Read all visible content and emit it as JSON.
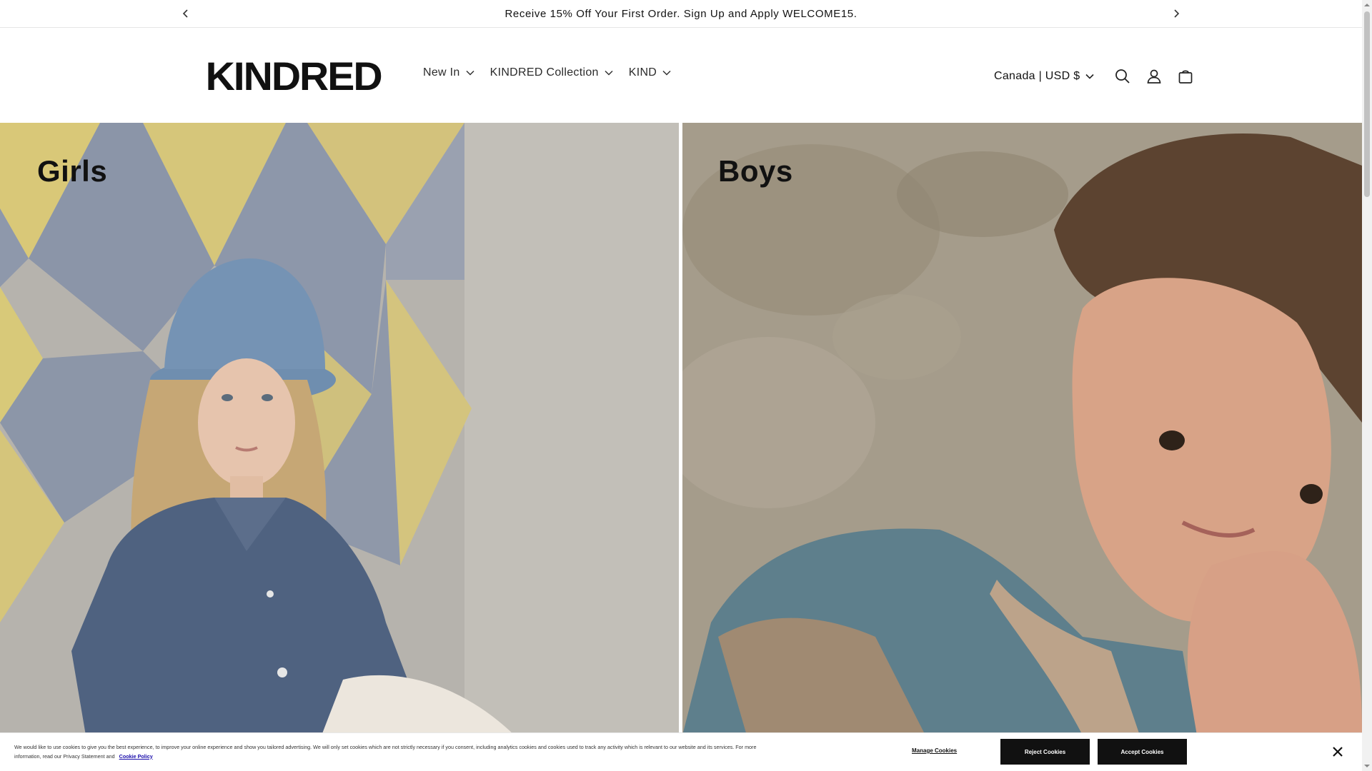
{
  "announcement": {
    "text": "Receive 15% Off Your First Order. Sign Up and Apply WELCOME15.",
    "prev_icon": "chevron-left-icon",
    "next_icon": "chevron-right-icon"
  },
  "header": {
    "logo": "KINDRED",
    "nav": [
      {
        "label": "New In"
      },
      {
        "label": "KINDRED Collection"
      },
      {
        "label": "KIND"
      }
    ],
    "currency": "Canada | USD $",
    "icons": [
      "search-icon",
      "account-icon",
      "cart-icon"
    ]
  },
  "hero": {
    "left_title": "Girls",
    "right_title": "Boys"
  },
  "cookie": {
    "text": "We would like to use cookies to give you the best experience, to improve your online experience and show you tailored advertising. We will only set cookies which are not strictly necessary if you consent, including analytics cookies and cookies used to track any activity which is relevant to our website and its services. For more information, read our Privacy Statement and",
    "link": "Cookie Policy",
    "manage": "Manage Cookies",
    "reject": "Reject Cookies",
    "accept": "Accept Cookies"
  },
  "colors": {
    "text": "#121212",
    "button_bg": "#111111",
    "link": "#1a0dab"
  }
}
